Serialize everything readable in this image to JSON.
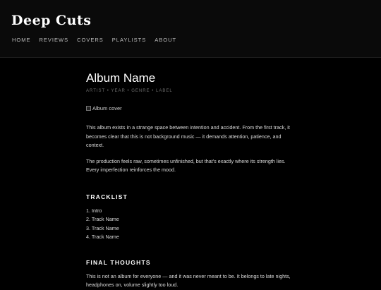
{
  "header": {
    "brand": "Deep Cuts",
    "nav": [
      "HOME",
      "REVIEWS",
      "COVERS",
      "PLAYLISTS",
      "ABOUT"
    ]
  },
  "album": {
    "title": "Album Name",
    "meta": "ARTIST • YEAR • GENRE • LABEL",
    "cover_alt": "Album cover"
  },
  "review": {
    "paragraphs": [
      "This album exists in a strange space between intention and accident. From the first track, it becomes clear that this is not background music — it demands attention, patience, and context.",
      "The production feels raw, sometimes unfinished, but that's exactly where its strength lies. Every imperfection reinforces the mood."
    ],
    "tracklist_heading": "TRACKLIST",
    "tracks": [
      "1. Intro",
      "2. Track Name",
      "3. Track Name",
      "4. Track Name"
    ],
    "final_heading": "FINAL THOUGHTS",
    "final_text": "This is not an album for everyone — and it was never meant to be. It belongs to late nights, headphones on, volume slightly too loud."
  }
}
